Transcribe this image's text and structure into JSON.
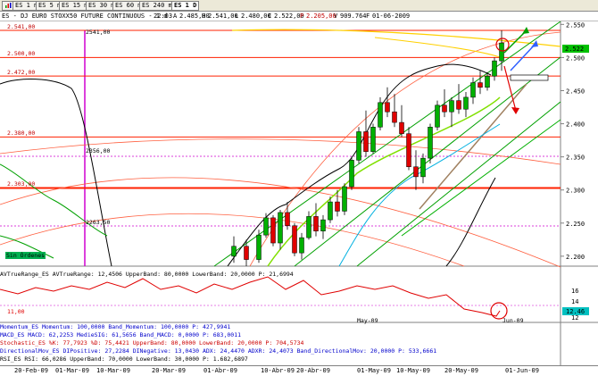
{
  "toolbar": {
    "app_icon": "chart-app-icon",
    "tabs": [
      {
        "label": "ES 1 m",
        "active": false
      },
      {
        "label": "ES 5 m",
        "active": false
      },
      {
        "label": "ES 15 m",
        "active": false
      },
      {
        "label": "ES 30 m",
        "active": false
      },
      {
        "label": "ES 60 m",
        "active": false
      },
      {
        "label": "ES 240 m",
        "active": false
      },
      {
        "label": "ES 1 D",
        "active": true
      }
    ]
  },
  "infobar": {
    "symbol": "ES - DJ EURO STOXX50 FUTURE CONTINUOUS - 1 d",
    "time": "22:03",
    "open_label": "A",
    "open": "2.485,00",
    "high_label": "H",
    "high": "2.541,00",
    "low_label": "L",
    "low": "2.480,00",
    "close_label": "C",
    "close": "2.522,00",
    "prev_label": "P",
    "prev": "2.205,00",
    "vol_label": "V",
    "vol": "909.764",
    "oi_label": "F",
    "oi": "01-06-2009"
  },
  "price_axis": {
    "ticks": [
      "2.550",
      "2.500",
      "2.450",
      "2.400",
      "2.350",
      "2.300",
      "2.250",
      "2.200"
    ],
    "current_price": "2.522",
    "indicator_ticks": [
      "16",
      "14",
      "12"
    ],
    "indicator_value": "12.46"
  },
  "horizontal_levels": [
    {
      "label": "2.541,00",
      "value": 2541
    },
    {
      "label": "2.500,00",
      "value": 2500
    },
    {
      "label": "2.472,00",
      "value": 2472
    },
    {
      "label": "2.380,00",
      "value": 2380
    },
    {
      "label": "2.303,00",
      "value": 2303
    }
  ],
  "annotations": {
    "top_price": "2541,00",
    "mid_price": "2356,00",
    "low_price": "2263,50",
    "sin_ordenes": "Sin Órdenes",
    "indicator_low": "11,00"
  },
  "indicator_header": "AVTrueRange_ES AVTrueRange: 12,4506 UpperBand: 80,0000 LowerBand: 20,0000 P: 21,6994",
  "indicator_rows": [
    {
      "text": "Momentum_ES Momentum: 100,0000 Band_Momentum: 100,0000 P: 427,9941",
      "color": "#0000cc"
    },
    {
      "text": "MACD_ES MACD: 62,2253 MedieSIG: 61,5656 Band_MACD: 0,0000 P: 683,0011",
      "color": "#0000cc"
    },
    {
      "text": "Stochastic_ES %K: 77,7923 %D: 75,4421 UpperBand: 80,0000 LowerBand: 20,0000 P: 704,5734",
      "color": "#cc0000"
    },
    {
      "text": "DirectionalMov_ES DIPositive: 27,2284 DINegative: 13,0430 ADX: 24,4470 ADXR: 24,4073 Band_DirectionalMov: 20,0000 P: 533,6661",
      "color": "#0000cc"
    },
    {
      "text": "RSI_ES RSI: 66,0286 UpperBand: 70,0000 LowerBand: 30,0000 P: 1.682,6897",
      "color": "#000000"
    }
  ],
  "date_axis": [
    "20-Feb-09",
    "01-Mar-09",
    "10-Mar-09",
    "20-Mar-09",
    "01-Abr-09",
    "10-Abr-09",
    "20-Abr-09",
    "01-May-09",
    "10-May-09",
    "20-May-09",
    "01-Jun-09"
  ],
  "date_axis_top": [
    "May-09",
    "Jun-09"
  ],
  "colors": {
    "up_candle": "#00b000",
    "down_candle": "#e00000",
    "level_line": "#ff2000",
    "magenta": "#d000d0",
    "channel_green": "#00a000",
    "channel_yellow": "#ffd000"
  }
}
